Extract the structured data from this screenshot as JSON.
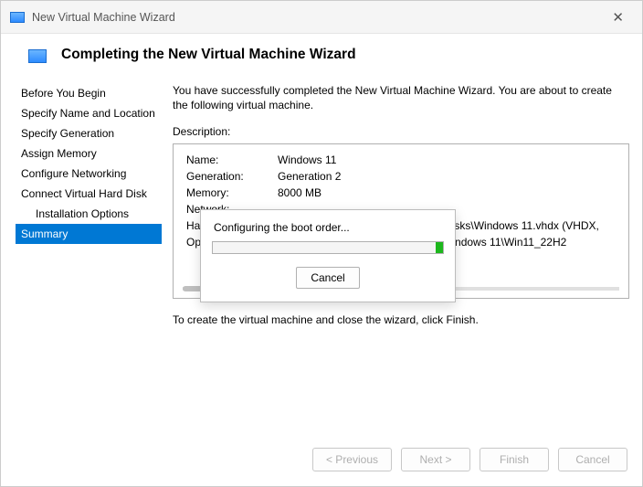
{
  "window": {
    "title": "New Virtual Machine Wizard",
    "heading": "Completing the New Virtual Machine Wizard"
  },
  "nav": {
    "items": [
      {
        "label": "Before You Begin"
      },
      {
        "label": "Specify Name and Location"
      },
      {
        "label": "Specify Generation"
      },
      {
        "label": "Assign Memory"
      },
      {
        "label": "Configure Networking"
      },
      {
        "label": "Connect Virtual Hard Disk"
      },
      {
        "label": "Installation Options",
        "indent": true
      },
      {
        "label": "Summary",
        "selected": true
      }
    ]
  },
  "content": {
    "intro": "You have successfully completed the New Virtual Machine Wizard. You are about to create the following virtual machine.",
    "description_label": "Description:",
    "rows": [
      {
        "k": "Name:",
        "v": "Windows 11"
      },
      {
        "k": "Generation:",
        "v": "Generation 2"
      },
      {
        "k": "Memory:",
        "v": "8000 MB"
      },
      {
        "k": "Network:",
        "v": ""
      },
      {
        "k": "Hard Disk:",
        "v": "                                        ual Hard Disks\\Windows 11.vhdx (VHDX,"
      },
      {
        "k": "Operating System:",
        "v": "                               ows\\Microsoft Windows 11\\Win11_22H2"
      }
    ],
    "finish_hint": "To create the virtual machine and close the wizard, click Finish."
  },
  "progress": {
    "message": "Configuring the boot order...",
    "percent": 98,
    "cancel": "Cancel"
  },
  "footer": {
    "previous": "< Previous",
    "next": "Next >",
    "finish": "Finish",
    "cancel": "Cancel"
  }
}
